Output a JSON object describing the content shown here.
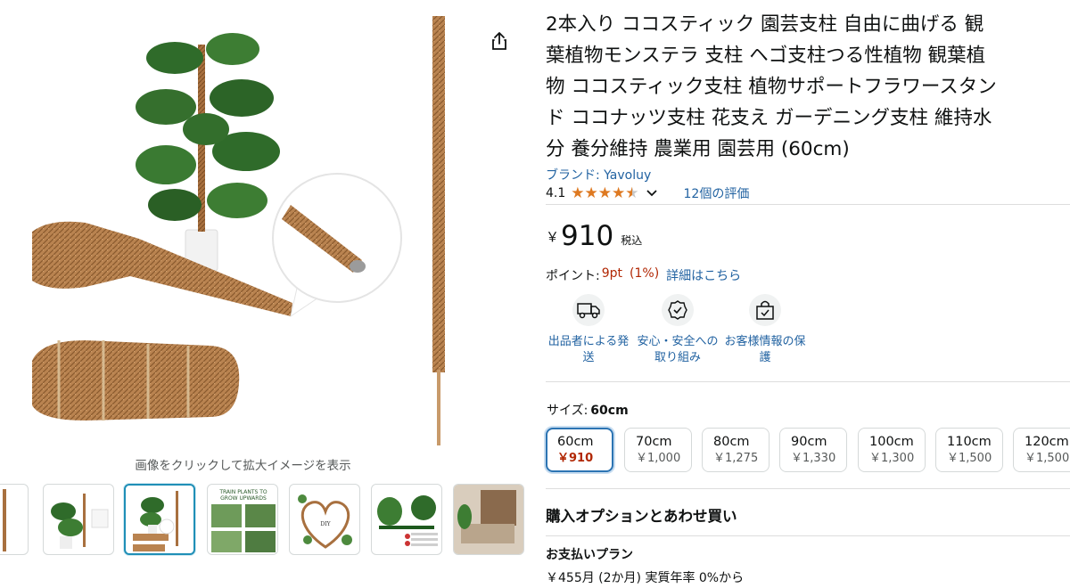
{
  "gallery": {
    "zoom_caption": "画像をクリックして拡大イメージを表示",
    "share_icon": "share-icon",
    "thumbnails": [
      {
        "name": "thumbnail-1"
      },
      {
        "name": "thumbnail-2"
      },
      {
        "name": "thumbnail-3",
        "active": true
      },
      {
        "name": "thumbnail-4",
        "caption": "TRAIN PLANTS TO GROW UPWARDS"
      },
      {
        "name": "thumbnail-5",
        "caption": "DIY Your Plants"
      },
      {
        "name": "thumbnail-6"
      },
      {
        "name": "thumbnail-7"
      }
    ]
  },
  "product": {
    "title_lines": [
      "2本入り ココスティック 園芸支柱 自由に曲げる 観",
      "葉植物モンステラ 支柱 ヘゴ支柱つる性植物 観葉植",
      "物 ココスティック支柱 植物サポートフラワースタン",
      "ド ココナッツ支柱 花支え ガーデニング支柱 維持水",
      "分 養分維持 農業用 園芸用 (60cm)"
    ],
    "brand": "ブランド: Yavoluy",
    "rating": {
      "value": "4.1",
      "stars": 4.1,
      "out_of": 5,
      "reviews": "12個の評価"
    },
    "price": {
      "symbol": "￥",
      "value": "910",
      "tax": "税込"
    },
    "points": {
      "label": "ポイント:",
      "value": "9pt",
      "pct": "(1%)",
      "link": "詳細はこちら"
    },
    "features": [
      {
        "icon": "truck-icon",
        "line1": "出品者による発",
        "line2": "送"
      },
      {
        "icon": "badge-check-icon",
        "line1": "安心・安全への",
        "line2": "取り組み"
      },
      {
        "icon": "lock-bag-icon",
        "line1": "お客様情報の保",
        "line2": "護"
      }
    ],
    "size": {
      "label": "サイズ:",
      "selected": "60cm",
      "options": [
        {
          "name": "60cm",
          "price": "￥910",
          "selected": true
        },
        {
          "name": "70cm",
          "price": "￥1,000"
        },
        {
          "name": "80cm",
          "price": "￥1,275"
        },
        {
          "name": "90cm",
          "price": "￥1,330"
        },
        {
          "name": "100cm",
          "price": "￥1,300"
        },
        {
          "name": "110cm",
          "price": "￥1,500"
        },
        {
          "name": "120cm",
          "price": "￥1,500"
        }
      ]
    },
    "buy_options_heading": "購入オプションとあわせ買い",
    "payment": {
      "heading": "お支払いプラン",
      "line": "￥455月 (2か月) 実質年率 0%から"
    }
  },
  "colors": {
    "link": "#2162a1",
    "price_red": "#b12704",
    "star": "#de7921",
    "selected_border": "#2c74b3"
  }
}
